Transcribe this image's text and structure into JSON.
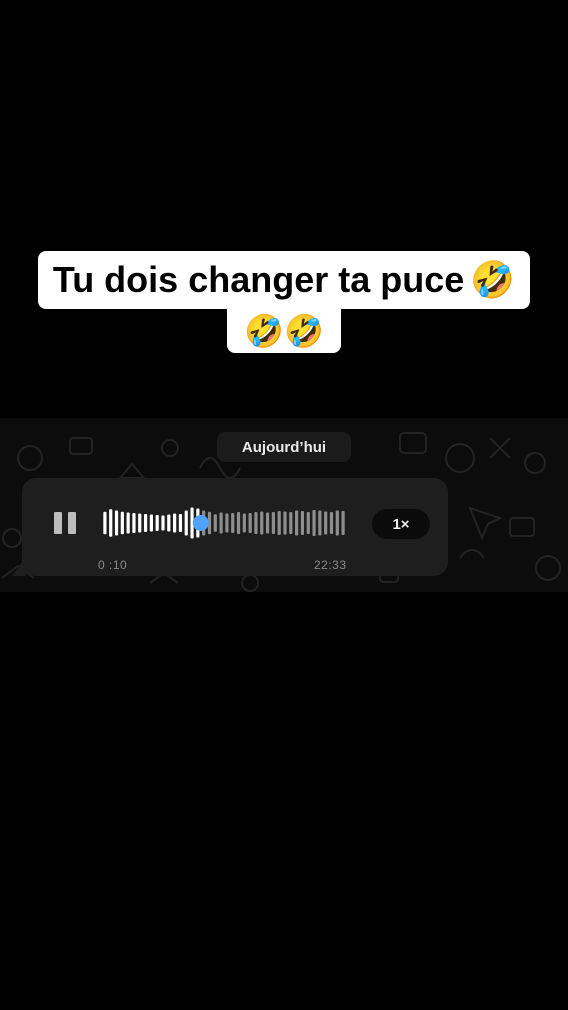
{
  "caption": {
    "line1_text": "Tu dois changer ta puce",
    "line1_emoji": "🤣",
    "line2_emoji": "🤣🤣"
  },
  "chat": {
    "date_label": "Aujourd’hui",
    "voice_message": {
      "elapsed": "0 :10",
      "duration": "22:33",
      "speed": "1×",
      "progress": 0.4,
      "played_color": "#ffffff",
      "unplayed_color": "#8e8e8e",
      "knob_color": "#4da3ff",
      "bar_levels": [
        0.45,
        0.55,
        0.5,
        0.45,
        0.42,
        0.4,
        0.38,
        0.36,
        0.34,
        0.32,
        0.3,
        0.34,
        0.38,
        0.36,
        0.5,
        0.62,
        0.58,
        0.5,
        0.45,
        0.35,
        0.42,
        0.38,
        0.4,
        0.44,
        0.38,
        0.4,
        0.44,
        0.46,
        0.42,
        0.44,
        0.48,
        0.46,
        0.44,
        0.5,
        0.48,
        0.44,
        0.52,
        0.5,
        0.46,
        0.44,
        0.5,
        0.48
      ]
    }
  },
  "colors": {
    "background": "#000000",
    "chat_background": "#0c0c0c",
    "bubble": "#1e1e1e",
    "caption_bg": "#ffffff"
  }
}
